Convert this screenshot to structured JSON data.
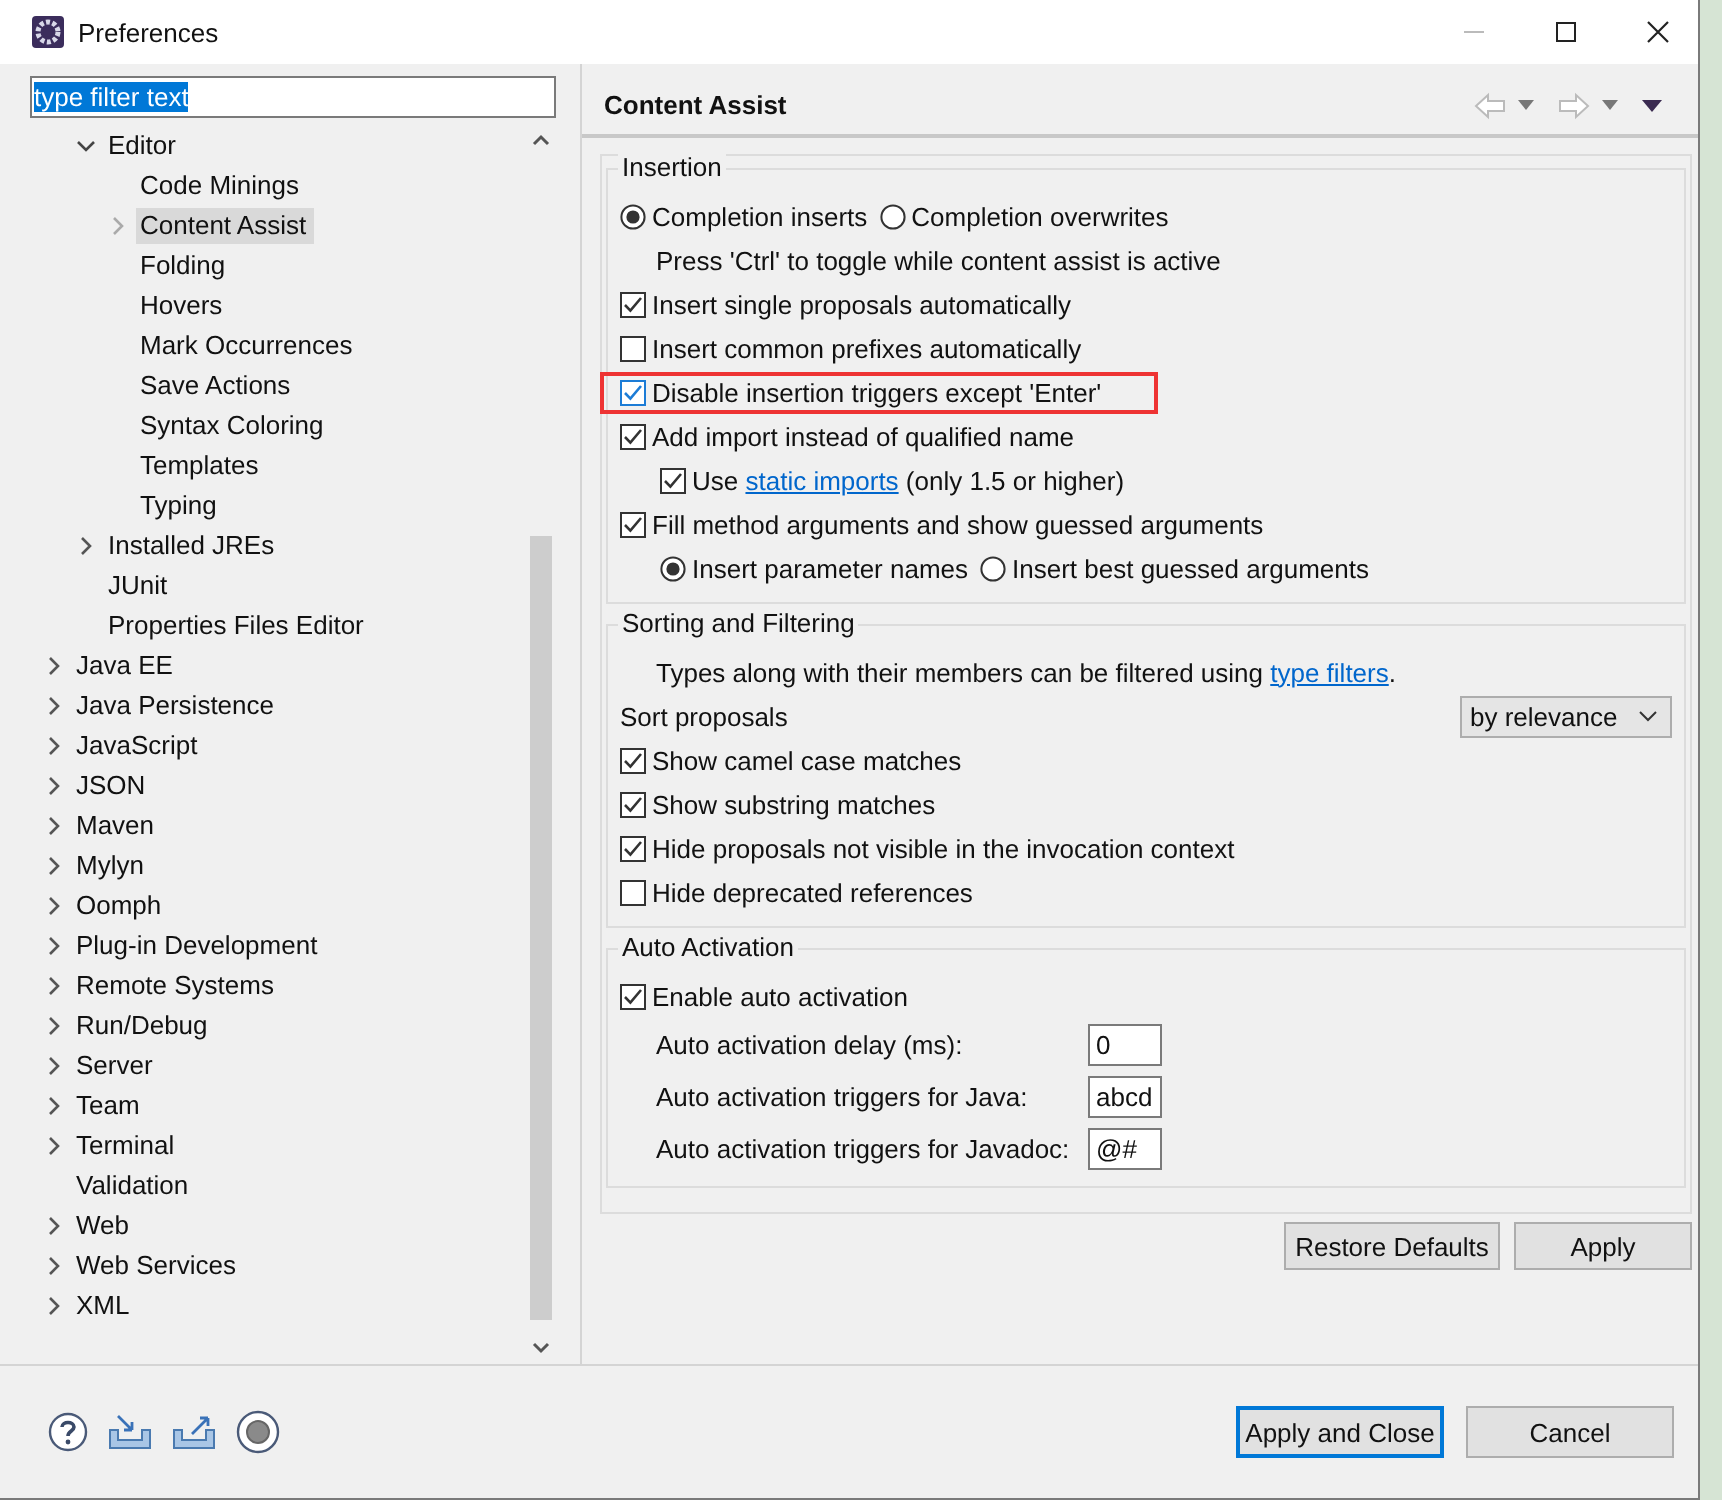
{
  "window": {
    "title": "Preferences"
  },
  "filter": {
    "value": "type filter text",
    "selected": true
  },
  "tree": [
    {
      "children": [
        {
          "label": "Editor",
          "expanded": true,
          "selected": false,
          "children": [
            {
              "label": "Code Minings",
              "selected": false
            },
            {
              "label": "Content Assist",
              "expanded": false,
              "selected": true
            },
            {
              "label": "Folding",
              "selected": false
            },
            {
              "label": "Hovers",
              "selected": false
            },
            {
              "label": "Mark Occurrences",
              "selected": false
            },
            {
              "label": "Save Actions",
              "selected": false
            },
            {
              "label": "Syntax Coloring",
              "selected": false
            },
            {
              "label": "Templates",
              "selected": false
            },
            {
              "label": "Typing",
              "selected": false
            }
          ]
        },
        {
          "label": "Installed JREs",
          "expanded": false,
          "selected": false
        },
        {
          "label": "JUnit",
          "selected": false
        },
        {
          "label": "Properties Files Editor",
          "selected": false
        }
      ]
    },
    {
      "label": "Java EE",
      "expanded": false,
      "selected": false
    },
    {
      "label": "Java Persistence",
      "expanded": false,
      "selected": false
    },
    {
      "label": "JavaScript",
      "expanded": false,
      "selected": false
    },
    {
      "label": "JSON",
      "expanded": false,
      "selected": false
    },
    {
      "label": "Maven",
      "expanded": false,
      "selected": false
    },
    {
      "label": "Mylyn",
      "expanded": false,
      "selected": false
    },
    {
      "label": "Oomph",
      "expanded": false,
      "selected": false
    },
    {
      "label": "Plug-in Development",
      "expanded": false,
      "selected": false
    },
    {
      "label": "Remote Systems",
      "expanded": false,
      "selected": false
    },
    {
      "label": "Run/Debug",
      "expanded": false,
      "selected": false
    },
    {
      "label": "Server",
      "expanded": false,
      "selected": false
    },
    {
      "label": "Team",
      "expanded": false,
      "selected": false
    },
    {
      "label": "Terminal",
      "expanded": false,
      "selected": false
    },
    {
      "label": "Validation",
      "selected": false
    },
    {
      "label": "Web",
      "expanded": false,
      "selected": false
    },
    {
      "label": "Web Services",
      "expanded": false,
      "selected": false
    },
    {
      "label": "XML",
      "expanded": false,
      "selected": false
    }
  ],
  "page": {
    "title": "Content Assist"
  },
  "sections": [
    {
      "title": "Insertion",
      "rows": [
        {
          "kind": "radios",
          "options": [
            {
              "label": "Completion inserts",
              "selected": true
            },
            {
              "label": "Completion overwrites",
              "selected": false
            }
          ]
        },
        {
          "kind": "note",
          "text": "Press 'Ctrl' to toggle while content assist is active"
        },
        {
          "kind": "check",
          "label": "Insert single proposals automatically",
          "checked": true,
          "highlighted": false
        },
        {
          "kind": "check",
          "label": "Insert common prefixes automatically",
          "checked": false,
          "highlighted": false
        },
        {
          "kind": "check",
          "label": "Disable insertion triggers except 'Enter'",
          "checked": true,
          "highlighted": true
        },
        {
          "kind": "check",
          "label": "Add import instead of qualified name",
          "checked": true,
          "highlighted": false,
          "children": [
            {
              "kind": "check",
              "label": "Use",
              "link": "static imports",
              "after": "(only 1.5 or higher)",
              "checked": true,
              "highlighted": false
            }
          ]
        },
        {
          "kind": "check",
          "label": "Fill method arguments and show guessed arguments",
          "checked": true,
          "highlighted": false,
          "children": [
            {
              "kind": "radios",
              "options": [
                {
                  "label": "Insert parameter names",
                  "selected": true
                },
                {
                  "label": "Insert best guessed arguments",
                  "selected": false
                }
              ]
            }
          ]
        }
      ]
    },
    {
      "title": "Sorting and Filtering",
      "rows": [
        {
          "kind": "note",
          "text": "Types along with their members can be filtered using",
          "link": "type filters",
          "after": "."
        },
        {
          "kind": "select",
          "label": "Sort proposals",
          "value": "by relevance"
        },
        {
          "kind": "check",
          "label": "Show camel case matches",
          "checked": true,
          "highlighted": false
        },
        {
          "kind": "check",
          "label": "Show substring matches",
          "checked": true,
          "highlighted": false
        },
        {
          "kind": "check",
          "label": "Hide proposals not visible in the invocation context",
          "checked": true,
          "highlighted": false
        },
        {
          "kind": "check",
          "label": "Hide deprecated references",
          "checked": false,
          "highlighted": false
        }
      ]
    },
    {
      "title": "Auto Activation",
      "rows": [
        {
          "kind": "check",
          "label": "Enable auto activation",
          "checked": true,
          "highlighted": false
        },
        {
          "kind": "field",
          "label": "Auto activation delay (ms):",
          "value": "0"
        },
        {
          "kind": "field",
          "label": "Auto activation triggers for Java:",
          "value": "abcd"
        },
        {
          "kind": "field",
          "label": "Auto activation triggers for Javadoc:",
          "value": "@#"
        }
      ]
    }
  ],
  "page_buttons": [
    "Restore Defaults",
    "Apply"
  ],
  "dialog_buttons": [
    {
      "label": "Apply and Close",
      "default": true
    },
    {
      "label": "Cancel",
      "default": false
    }
  ]
}
